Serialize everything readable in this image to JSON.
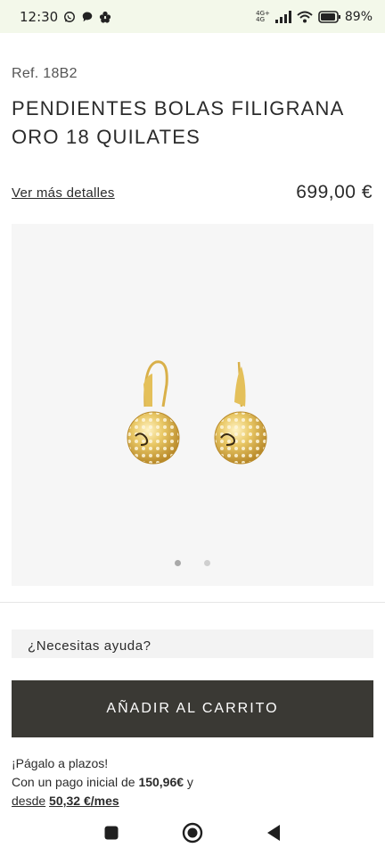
{
  "status_bar": {
    "time": "12:30",
    "network_top": "4G+",
    "network_bottom": "4G",
    "battery": "89%"
  },
  "product": {
    "ref": "Ref. 18B2",
    "title": "PENDIENTES BOLAS FILIGRANA ORO 18 QUILATES",
    "details_link": "Ver más detalles",
    "price": "699,00 €"
  },
  "gallery": {
    "image_icon": "gold-filigree-ball-earrings-image",
    "dots": [
      true,
      false
    ]
  },
  "help": {
    "label": "¿Necesitas ayuda?"
  },
  "cart": {
    "button_label": "AÑADIR AL CARRITO"
  },
  "financing": {
    "line1": "¡Págalo a plazos!",
    "line2_prefix": "Con un pago inicial de ",
    "initial_amount": "150,96€",
    "line2_suffix": " y",
    "line3_prefix": "desde",
    "monthly_amount": "50,32 €/mes"
  },
  "colors": {
    "status_bg": "#f3f8ea",
    "button_bg": "#3a3934",
    "gold": "#e0b94a"
  }
}
